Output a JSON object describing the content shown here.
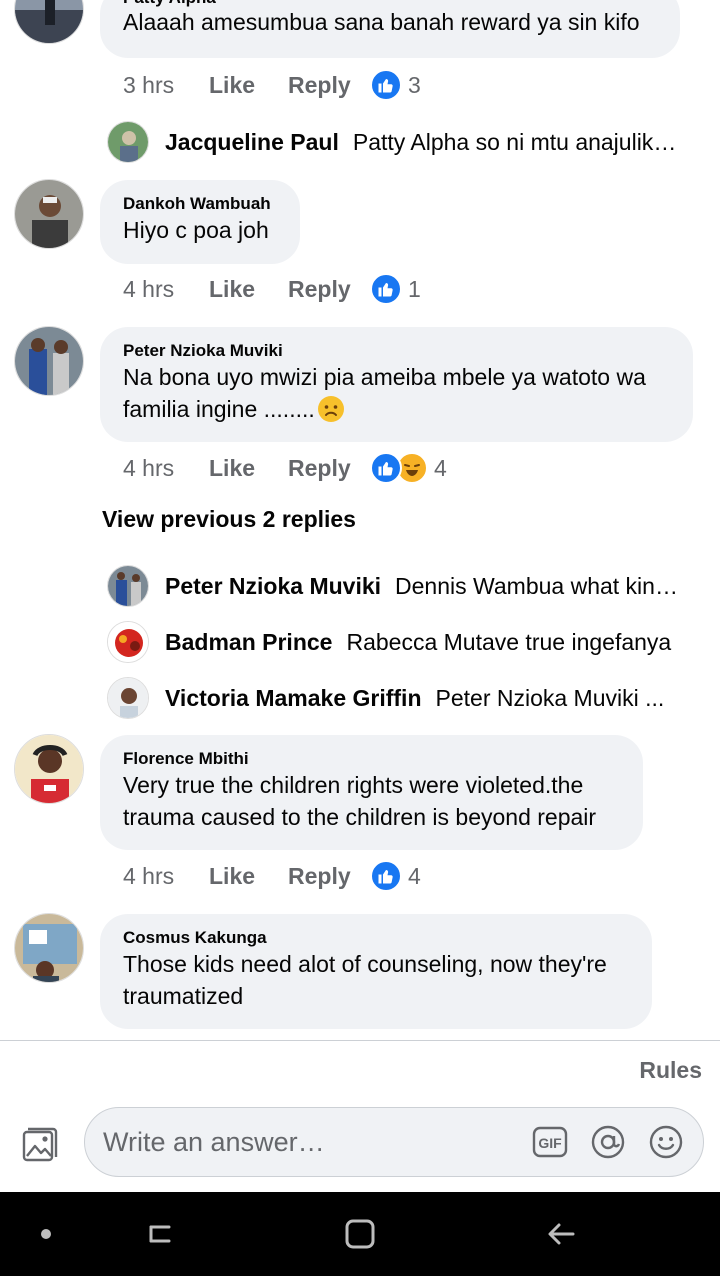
{
  "comments": [
    {
      "author": "Patty Alpha",
      "text": "Alaaah amesumbua sana banah reward ya sin kifo",
      "time": "3 hrs",
      "like_label": "Like",
      "reply_label": "Reply",
      "reaction_count": "3"
    },
    {
      "author": "Dankoh Wambuah",
      "text": "Hiyo c poa joh",
      "time": "4 hrs",
      "like_label": "Like",
      "reply_label": "Reply",
      "reaction_count": "1"
    },
    {
      "author": "Peter Nzioka Muviki",
      "text_line1": "Na bona uyo mwizi pia ameiba mbele ya watoto wa",
      "text_line2": "familia ingine ........",
      "time": "4 hrs",
      "like_label": "Like",
      "reply_label": "Reply",
      "reaction_count": "4"
    },
    {
      "author": "Florence Mbithi",
      "text_line1": "Very true the children rights were violeted.the",
      "text_line2": "trauma caused to the children is beyond repair",
      "time": "4 hrs",
      "like_label": "Like",
      "reply_label": "Reply",
      "reaction_count": "4"
    },
    {
      "author": "Cosmus Kakunga",
      "text_line1": "Those kids need alot of counseling, now they're",
      "text_line2": "traumatized"
    }
  ],
  "replies_patty": [
    {
      "author": "Jacqueline Paul",
      "text": "Patty Alpha so ni mtu anajulikana"
    }
  ],
  "view_previous_label": "View previous 2 replies",
  "replies_peter": [
    {
      "author": "Peter Nzioka Muviki",
      "text": "Dennis Wambua what kind of"
    },
    {
      "author": "Badman Prince",
      "text": "Rabecca Mutave true ingefanya"
    },
    {
      "author": "Victoria Mamake Griffin",
      "text": "Peter Nzioka Muviki ..."
    }
  ],
  "composer": {
    "rules_label": "Rules",
    "placeholder": "Write an answer…",
    "gif_label": "GIF"
  },
  "colors": {
    "like_blue": "#1877f2",
    "bubble_bg": "#f0f2f5",
    "meta_gray": "#65676b"
  }
}
